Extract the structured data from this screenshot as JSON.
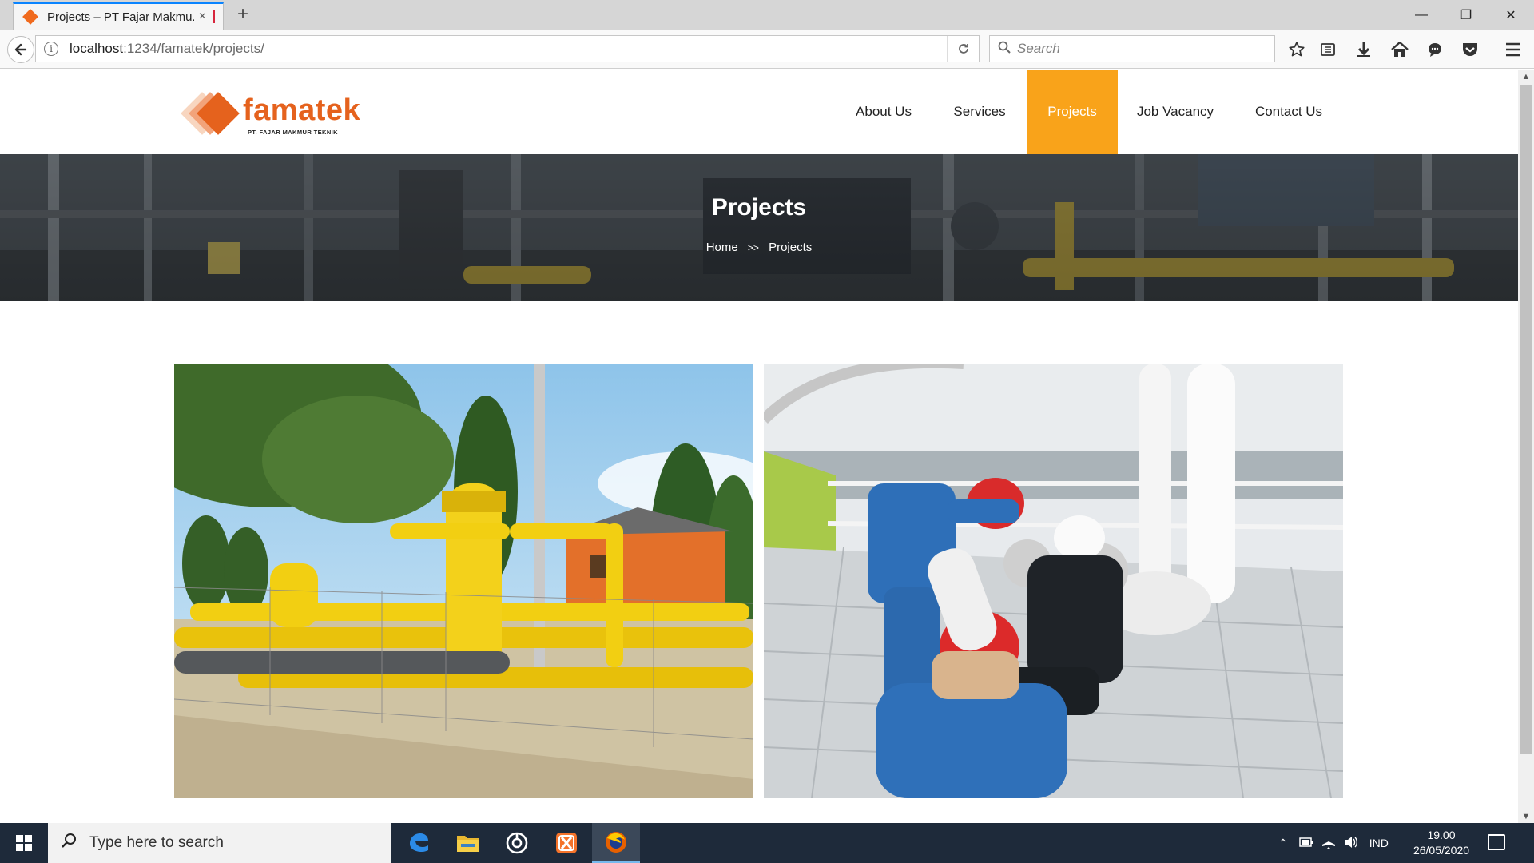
{
  "browser": {
    "tab_title": "Projects – PT Fajar Makmu...",
    "tab_close": "×",
    "new_tab": "+",
    "url_host": "localhost",
    "url_path": ":1234/famatek/projects/",
    "search_placeholder": "Search",
    "window_controls": {
      "minimize": "—",
      "restore": "❐",
      "close": "✕"
    },
    "toolbar_icons": [
      "bookmark-star-icon",
      "reading-list-icon",
      "download-icon",
      "home-icon",
      "chat-icon",
      "pocket-icon",
      "menu-icon"
    ]
  },
  "site": {
    "logo_word": "famatek",
    "logo_sub": "PT. FAJAR MAKMUR TEKNIK",
    "brand_color": "#e5621d",
    "accent_color": "#f9a31a",
    "menu": [
      {
        "label": "About Us",
        "active": false
      },
      {
        "label": "Services",
        "active": false
      },
      {
        "label": "Projects",
        "active": true
      },
      {
        "label": "Job Vacancy",
        "active": false
      },
      {
        "label": "Contact Us",
        "active": false
      }
    ],
    "hero": {
      "title": "Projects",
      "breadcrumb_home": "Home",
      "breadcrumb_sep": ">>",
      "breadcrumb_current": "Projects"
    }
  },
  "taskbar": {
    "search_placeholder": "Type here to search",
    "apps": [
      "edge-icon",
      "file-explorer-icon",
      "media-app-icon",
      "xampp-icon",
      "firefox-icon"
    ],
    "language": "IND",
    "time": "19.00",
    "date": "26/05/2020"
  }
}
